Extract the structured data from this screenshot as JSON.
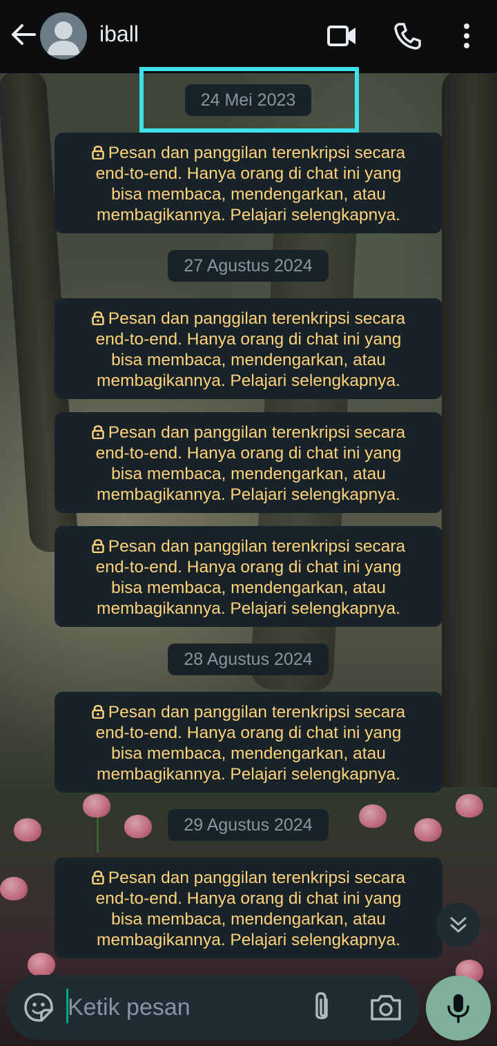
{
  "header": {
    "contact_name": "iball",
    "icons": [
      "back-arrow-icon",
      "avatar-icon",
      "video-call-icon",
      "phone-icon",
      "more-vert-icon"
    ]
  },
  "chat": {
    "dates": [
      "24 Mei 2023",
      "27 Agustus 2024",
      "28 Agustus 2024",
      "29 Agustus 2024"
    ],
    "encryption_notice": {
      "line1": "Pesan dan panggilan terenkripsi secara",
      "line2": "end-to-end. Hanya orang di chat ini yang",
      "line3": "bisa membaca, mendengarkan, atau",
      "line4": "membagikannya. Pelajari selengkapnya."
    }
  },
  "composer": {
    "placeholder": "Ketik pesan",
    "value": "",
    "icons": [
      "sticker-icon",
      "attach-icon",
      "camera-icon",
      "mic-icon"
    ]
  },
  "colors": {
    "header_bg": "#0b0d0e",
    "bubble_bg": "#182229",
    "notice_text": "#ffd279",
    "date_text": "#8696a0",
    "highlight": "#3de3ea",
    "mic_button": "#7fb19a"
  }
}
